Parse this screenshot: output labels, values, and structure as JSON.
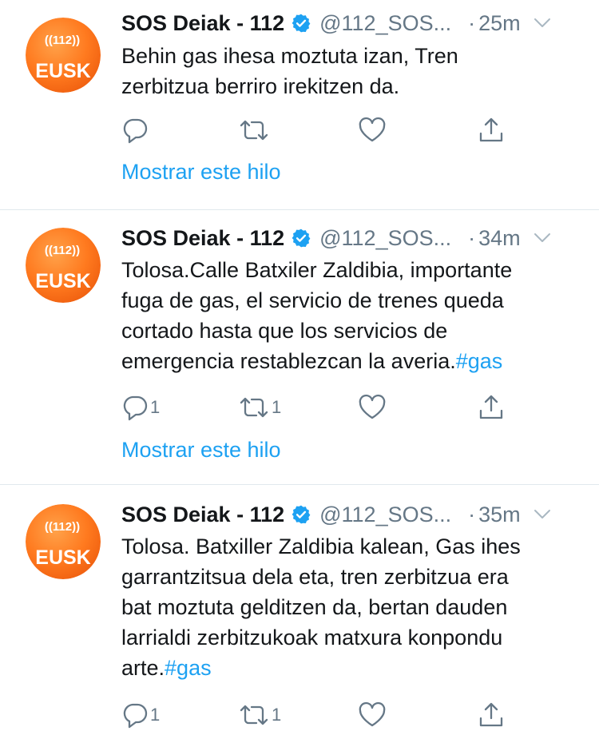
{
  "tweets": [
    {
      "avatar_top": "((112))",
      "avatar_bottom": "EUSK",
      "name": "SOS Deiak - 112",
      "handle": "@112_SOS...",
      "dot": "·",
      "time": "25m",
      "text": "Behin gas ihesa moztuta izan, Tren\nzerbitzua berriro irekitzen da.",
      "hashtag": "",
      "reply_count": "",
      "retweet_count": "",
      "thread_link": "Mostrar este hilo"
    },
    {
      "avatar_top": "((112))",
      "avatar_bottom": "EUSK",
      "name": "SOS Deiak - 112",
      "handle": "@112_SOS...",
      "dot": "·",
      "time": "34m",
      "text": "Tolosa.Calle Batxiler Zaldibia, importante\nfuga de gas, el servicio de trenes queda\ncortado  hasta que los servicios de\nemergencia restablezcan la averia.",
      "hashtag": "#gas",
      "reply_count": "1",
      "retweet_count": "1",
      "thread_link": "Mostrar este hilo"
    },
    {
      "avatar_top": "((112))",
      "avatar_bottom": "EUSK",
      "name": "SOS Deiak - 112",
      "handle": "@112_SOS...",
      "dot": "·",
      "time": "35m",
      "text": "Tolosa. Batxiller Zaldibia kalean, Gas ihes\ngarrantzitsua  dela eta, tren zerbitzua era\nbat moztuta gelditzen da, bertan dauden\nlarrialdi zerbitzukoak matxura konpondu\narte.",
      "hashtag": "#gas",
      "reply_count": "1",
      "retweet_count": "1",
      "thread_link": ""
    }
  ],
  "icons": {
    "verified": "verified-badge-icon",
    "caret": "chevron-down-icon",
    "reply": "reply-icon",
    "retweet": "retweet-icon",
    "like": "like-icon",
    "share": "share-icon"
  },
  "colors": {
    "text": "#14171a",
    "secondary": "#657786",
    "link": "#1da1f2",
    "divider": "#e1e8ed",
    "avatar_orange": "#ff6a13"
  }
}
